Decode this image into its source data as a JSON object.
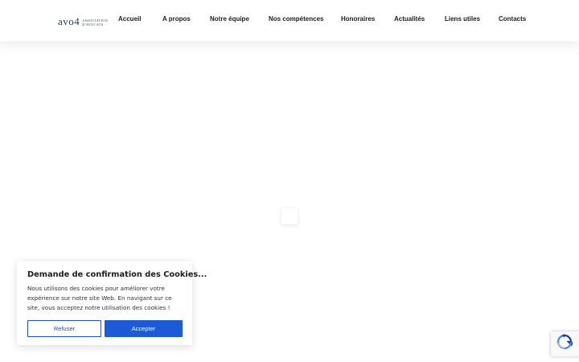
{
  "logo": {
    "main": "avo4",
    "sub_line1": "ASSOCIATION",
    "sub_line2": "D'AVOCATS"
  },
  "nav": {
    "items": [
      {
        "label": "Accueil"
      },
      {
        "label": "A propos"
      },
      {
        "label": "Notre équipe"
      },
      {
        "label": "Nos compétences"
      },
      {
        "label": "Honoraires"
      },
      {
        "label": "Actualités"
      },
      {
        "label": "Liens utiles"
      },
      {
        "label": "Contacts"
      }
    ]
  },
  "cookie_banner": {
    "title": "Demande de confirmation des Cookies...",
    "text": "Nous utilisons des cookies pour améliorer votre expérience sur notre site Web. En navigant sur ce site, vous acceptez notre utilisation des cookies !",
    "refuse_label": "Refuser",
    "accept_label": "Accepter"
  },
  "colors": {
    "accent": "#1d5ad6",
    "nav_text": "#1c1c1c",
    "logo": "#2a3a52"
  },
  "icons": {
    "recaptcha": "recaptcha-icon",
    "loader": "loading-spinner"
  }
}
